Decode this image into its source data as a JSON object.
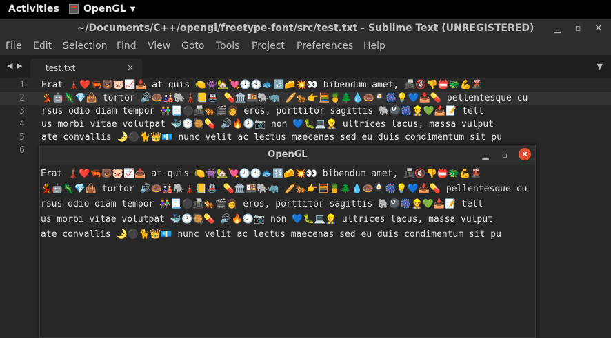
{
  "topbar": {
    "activities": "Activities",
    "app_name": "OpenGL"
  },
  "sublime": {
    "title": "~/Documents/C++/opengl/freetype-font/src/test.txt - Sublime Text (UNREGISTERED)",
    "menu": [
      "File",
      "Edit",
      "Selection",
      "Find",
      "View",
      "Goto",
      "Tools",
      "Project",
      "Preferences",
      "Help"
    ],
    "tab": {
      "label": "test.txt",
      "close": "×"
    },
    "line_numbers": [
      "1",
      "2",
      "3",
      "4",
      "5",
      "6"
    ],
    "lines": [
      "Erat 🗼❤️🦐🐻🐷📈📥 at quis 🍋👾🏡💘🕗🕙🐟🔢🧀💥👀 bibendum amet, 📠🔇👎📛🐲💪🌋",
      "💃🤖🦎💎👜 tortor 🔊🍩🎎🐘🗼📒🚇 💊🏛️🍱🐘🦏 🥖🐅👉🧮🍍🌲💧🍩🍳🎆💡💙📥💊 pellentesque cu",
      "rsus odio diam tempor 👫📃⚫📠🐅🎬👩 eros, porttitor sagittis 🐘🎱🎆👷💚📥📝 tell",
      "us morbi vitae volutpat 🐳🕐🥘💊 🔊🔥🕗📷 non 💙🐛💻👷 ultrices lacus, massa vulput",
      "ate convallis 🌛⚫🐈👑💶 nunc velit ac lectus maecenas sed eu duis condimentum sit pu",
      ""
    ]
  },
  "gl_window": {
    "title": "OpenGL",
    "close": "×",
    "lines": [
      "Erat 🗼❤️🦐🐻🐷📈📥 at quis 🍋👾🏡💘🕗🕙🐟🔢🧀💥👀 bibendum amet, 📠🔇👎📛🐲💪🌋",
      "💃🤖🦎💎👜 tortor 🔊🍩🎎🐘🗼📒🚇 💊🏛️🍱🐘🦏 🥖🐅👉🧮🍍🌲💧🍩🍳🎆💡💙📥💊 pellentesque cu",
      "rsus odio diam tempor 👫📃⚫📠🐅🎬👩 eros, porttitor sagittis 🐘🎱🎆👷💚📥📝 tell",
      "us morbi vitae volutpat 🐳🕐🥘💊 🔊🔥🕗📷 non 💙🐛💻👷 ultrices lacus, massa vulput",
      "ate convallis 🌛⚫🐈👑💶 nunc velit ac lectus maecenas sed eu duis condimentum sit pu"
    ]
  }
}
